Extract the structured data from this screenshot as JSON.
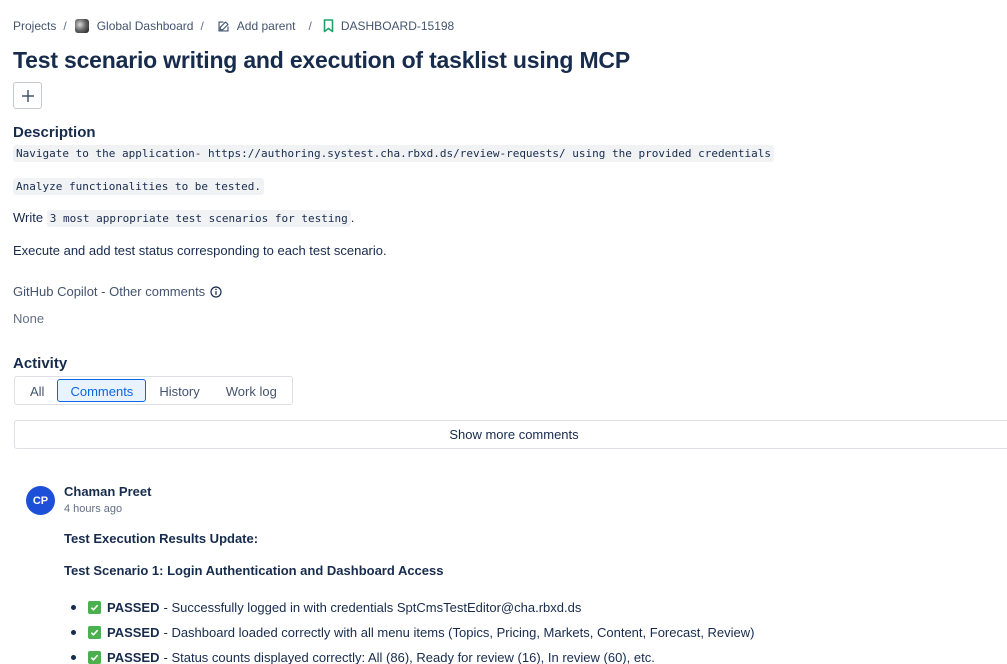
{
  "breadcrumb": {
    "projects": "Projects",
    "separator": "/",
    "project_name": "Global Dashboard",
    "add_parent": "Add parent",
    "issue_key": "DASHBOARD-15198",
    "project_icon": "project-avatar",
    "add_parent_icon": "edit-icon",
    "issue_icon": "bookmark-icon"
  },
  "title": "Test scenario writing and execution of tasklist using MCP",
  "add_button_icon": "plus-icon",
  "description": {
    "heading": "Description",
    "line1": "Navigate to the application- https://authoring.systest.cha.rbxd.ds/review-requests/ using the provided credentials",
    "line2": "Analyze functionalities to be tested.",
    "line3_prefix": "Write ",
    "line3_code": "3 most appropriate test scenarios for testing",
    "line3_suffix": ".",
    "line4": "Execute and add test status corresponding to each test scenario."
  },
  "copilot_field": {
    "label": "GitHub Copilot - Other comments",
    "value": "None",
    "icon": "info-icon"
  },
  "activity": {
    "heading": "Activity",
    "tabs": [
      {
        "label": "All",
        "active": false
      },
      {
        "label": "Comments",
        "active": true
      },
      {
        "label": "History",
        "active": false
      },
      {
        "label": "Work log",
        "active": false
      }
    ],
    "show_more": "Show more comments"
  },
  "comment": {
    "avatar_initials": "CP",
    "author": "Chaman Preet",
    "time": "4 hours ago",
    "heading": "Test Execution Results Update:",
    "scenario": "Test Scenario 1: Login Authentication and Dashboard Access",
    "results": [
      {
        "status": "PASSED",
        "text": "- Successfully logged in with credentials SptCmsTestEditor@cha.rbxd.ds"
      },
      {
        "status": "PASSED",
        "text": "- Dashboard loaded correctly with all menu items (Topics, Pricing, Markets, Content, Forecast, Review)"
      },
      {
        "status": "PASSED",
        "text": "- Status counts displayed correctly: All (86), Ready for review (16), In review (60), etc."
      }
    ]
  },
  "colors": {
    "text": "#172b4d",
    "accent": "#0c66e4",
    "avatar": "#1d4fd8",
    "check": "#4caf50",
    "bookmark": "#22a06b"
  }
}
